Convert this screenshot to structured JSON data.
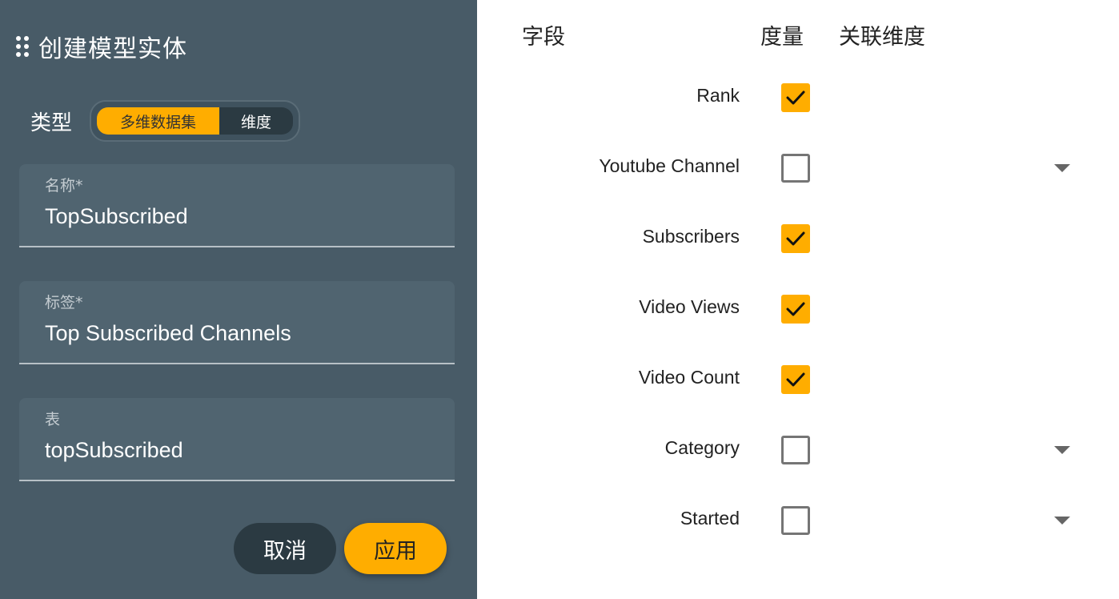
{
  "dialog": {
    "title": "创建模型实体",
    "type_label": "类型",
    "type_options": [
      "多维数据集",
      "维度"
    ],
    "type_selected": "多维数据集",
    "fields": [
      {
        "label": "名称*",
        "value": "TopSubscribed"
      },
      {
        "label": "标签*",
        "value": "Top Subscribed Channels"
      },
      {
        "label": "表",
        "value": "topSubscribed"
      }
    ],
    "cancel_label": "取消",
    "apply_label": "应用"
  },
  "columns": {
    "field": "字段",
    "measure": "度量",
    "dimension": "关联维度"
  },
  "rows": [
    {
      "name": "Rank",
      "measure": true,
      "has_dropdown": false
    },
    {
      "name": "Youtube Channel",
      "measure": false,
      "has_dropdown": true
    },
    {
      "name": "Subscribers",
      "measure": true,
      "has_dropdown": false
    },
    {
      "name": "Video Views",
      "measure": true,
      "has_dropdown": false
    },
    {
      "name": "Video Count",
      "measure": true,
      "has_dropdown": false
    },
    {
      "name": "Category",
      "measure": false,
      "has_dropdown": true
    },
    {
      "name": "Started",
      "measure": false,
      "has_dropdown": true
    }
  ],
  "colors": {
    "accent": "#ffad00",
    "panel_bg": "#485b67",
    "field_bg": "#506470"
  },
  "icons": {
    "drag_handle": "drag-handle-icon",
    "checkmark": "checkmark-icon",
    "dropdown": "caret-down-icon"
  }
}
